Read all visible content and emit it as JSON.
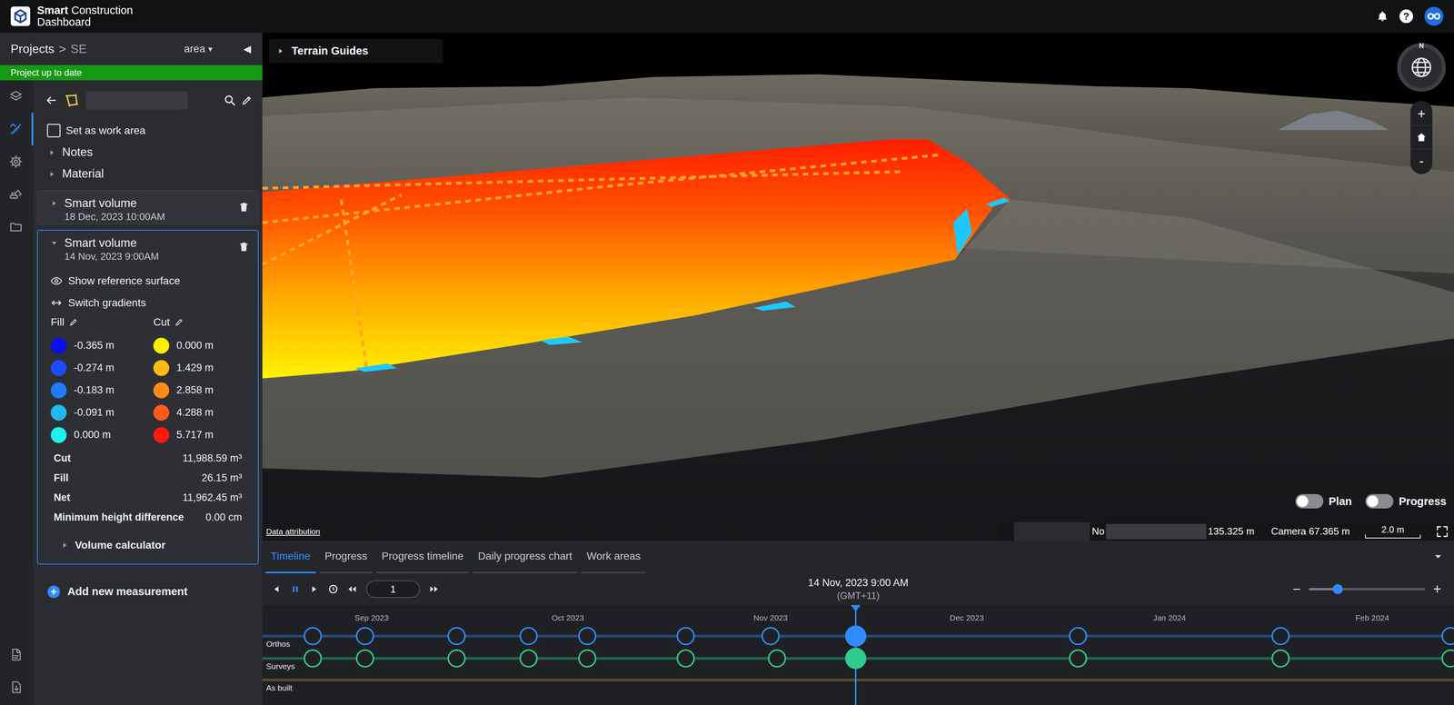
{
  "header": {
    "brand_bold": "Smart",
    "brand_rest": "Construction",
    "brand_line2": "Dashboard",
    "help": "?"
  },
  "breadcrumb": {
    "root": "Projects",
    "separator": ">",
    "project": "SE",
    "area": "area",
    "area_caret": "▾",
    "collapse": "◀"
  },
  "status_banner": "Project up to date",
  "rail": {
    "top": [
      {
        "kind": "layers",
        "selected": false
      },
      {
        "kind": "measure",
        "selected": true
      },
      {
        "kind": "settings",
        "selected": false
      },
      {
        "kind": "machines",
        "selected": false
      },
      {
        "kind": "files",
        "selected": false
      }
    ],
    "bottom": [
      {
        "kind": "pdf",
        "selected": false
      },
      {
        "kind": "download",
        "selected": false
      }
    ]
  },
  "toolbar": {
    "name_value": ""
  },
  "work_area": {
    "label": "Set as work area",
    "checked": false
  },
  "sections": [
    {
      "label": "Notes",
      "expanded": false
    },
    {
      "label": "Material",
      "expanded": false
    }
  ],
  "measurements": [
    {
      "title": "Smart volume",
      "date": "18 Dec, 2023 10:00AM",
      "expanded": false
    },
    {
      "title": "Smart volume",
      "date": "14 Nov, 2023 9:00AM",
      "expanded": true,
      "detail": {
        "actions": [
          {
            "kind": "eye",
            "label": "Show reference surface"
          },
          {
            "kind": "swap",
            "label": "Switch gradients"
          }
        ],
        "fill_label": "Fill",
        "cut_label": "Cut",
        "fill": [
          {
            "value": "-0.365 m",
            "color": "#0a0ff0"
          },
          {
            "value": "-0.274 m",
            "color": "#1a4cff"
          },
          {
            "value": "-0.183 m",
            "color": "#1f7cff"
          },
          {
            "value": "-0.091 m",
            "color": "#22b8f0"
          },
          {
            "value": "0.000 m",
            "color": "#20f0f0"
          }
        ],
        "cut": [
          {
            "value": "0.000 m",
            "color": "#ffee00"
          },
          {
            "value": "1.429 m",
            "color": "#ffbb10"
          },
          {
            "value": "2.858 m",
            "color": "#ff8a1a"
          },
          {
            "value": "4.288 m",
            "color": "#ff5a1a"
          },
          {
            "value": "5.717 m",
            "color": "#ff1a10"
          }
        ],
        "stats": [
          {
            "label": "Cut",
            "value": "11,988.59 m³"
          },
          {
            "label": "Fill",
            "value": "26.15 m³"
          },
          {
            "label": "Net",
            "value": "11,962.45 m³"
          },
          {
            "label": "Minimum height difference",
            "value": "0.00 cm"
          }
        ],
        "calculator": {
          "label": "Volume calculator",
          "expanded": false
        }
      }
    }
  ],
  "add_measurement": "Add new measurement",
  "viewport": {
    "guides": {
      "label": "Terrain Guides",
      "expanded": false
    },
    "compass": "N",
    "zoom": {
      "in": "+",
      "out": "-"
    },
    "toggles": [
      {
        "label": "Plan",
        "on": false
      },
      {
        "label": "Progress",
        "on": false
      }
    ],
    "attribution": "Data attribution",
    "status": {
      "north": "No",
      "easting": "135.325 m",
      "camera": "Camera 67.365 m",
      "scale": "2.0 m"
    }
  },
  "bottom_tabs": [
    {
      "label": "Timeline",
      "selected": true
    },
    {
      "label": "Progress",
      "selected": false
    },
    {
      "label": "Progress timeline",
      "selected": false
    },
    {
      "label": "Daily progress chart",
      "selected": false
    },
    {
      "label": "Work areas",
      "selected": false
    }
  ],
  "playback": {
    "playing": true,
    "step": "1",
    "date": "14 Nov, 2023 9:00 AM",
    "timezone": "(GMT+11)",
    "zoom_out": "−",
    "zoom_in": "+",
    "zoom_level": 0.25
  },
  "timeline": {
    "months": [
      {
        "label": "Sep 2023",
        "day": 0
      },
      {
        "label": "Oct 2023",
        "day": 30
      },
      {
        "label": "Nov 2023",
        "day": 61
      },
      {
        "label": "Dec 2023",
        "day": 91
      },
      {
        "label": "Jan 2024",
        "day": 122
      },
      {
        "label": "Feb 2024",
        "day": 153
      }
    ],
    "cursor_day": 74,
    "rows": [
      {
        "label": "Orthos",
        "color": "#2f8cff",
        "events": [
          {
            "day": -9,
            "selected": false
          },
          {
            "day": -1,
            "selected": false
          },
          {
            "day": 13,
            "selected": false
          },
          {
            "day": 24,
            "selected": false
          },
          {
            "day": 33,
            "selected": false
          },
          {
            "day": 48,
            "selected": false
          },
          {
            "day": 61,
            "selected": false
          },
          {
            "day": 74,
            "selected": true
          },
          {
            "day": 108,
            "selected": false
          },
          {
            "day": 139,
            "selected": false
          },
          {
            "day": 165,
            "selected": false
          }
        ]
      },
      {
        "label": "Surveys",
        "color": "#2ecc8f",
        "events": [
          {
            "day": -9,
            "selected": false
          },
          {
            "day": -1,
            "selected": false
          },
          {
            "day": 13,
            "selected": false
          },
          {
            "day": 24,
            "selected": false
          },
          {
            "day": 33,
            "selected": false
          },
          {
            "day": 48,
            "selected": false
          },
          {
            "day": 62,
            "selected": false
          },
          {
            "day": 74,
            "selected": true
          },
          {
            "day": 108,
            "selected": false
          },
          {
            "day": 139,
            "selected": false
          },
          {
            "day": 165,
            "selected": false
          }
        ]
      },
      {
        "label": "As built",
        "color": "#b09040",
        "events": []
      }
    ]
  }
}
